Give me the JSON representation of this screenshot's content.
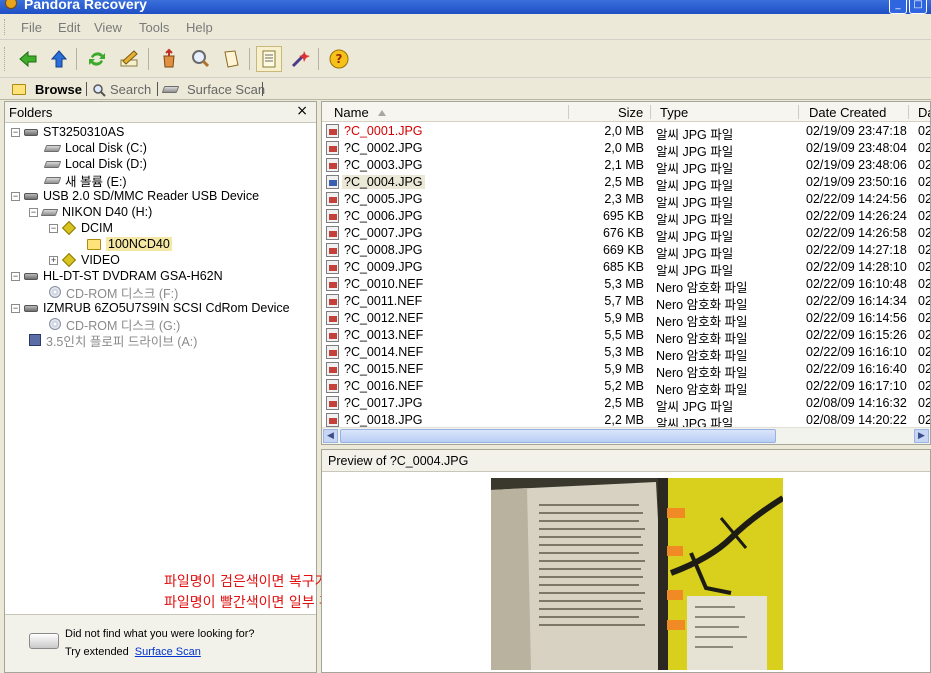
{
  "window": {
    "title": "Pandora Recovery"
  },
  "menu": [
    "File",
    "Edit",
    "View",
    "Tools",
    "Help"
  ],
  "tabs": [
    {
      "label": "Browse",
      "active": true
    },
    {
      "label": "Search",
      "active": false
    },
    {
      "label": "Surface Scan",
      "active": false
    }
  ],
  "folders": {
    "header": "Folders",
    "close": "×",
    "tree": [
      {
        "label": "ST3250310AS"
      },
      {
        "label": "Local Disk (C:)"
      },
      {
        "label": "Local Disk (D:)"
      },
      {
        "label": "새 볼륨 (E:)"
      },
      {
        "label": "USB 2.0 SD/MMC Reader USB Device"
      },
      {
        "label": "NIKON D40 (H:)"
      },
      {
        "label": "DCIM"
      },
      {
        "label": "100NCD40"
      },
      {
        "label": "VIDEO"
      },
      {
        "label": "HL-DT-ST DVDRAM GSA-H62N"
      },
      {
        "label": "CD-ROM 디스크 (F:)"
      },
      {
        "label": "IZMRUB 6ZO5U7S9IN SCSI CdRom Device"
      },
      {
        "label": "CD-ROM 디스크 (G:)"
      },
      {
        "label": "3.5인치 플로피 드라이브 (A:)"
      }
    ],
    "hint_line1": "Did not find what you were looking for?",
    "hint_line2": "Try extended",
    "hint_link": "Surface Scan"
  },
  "file_list": {
    "columns": {
      "name": "Name",
      "size": "Size",
      "type": "Type",
      "date": "Date Created",
      "extra": "Da"
    },
    "rows": [
      {
        "name": "?C_0001.JPG",
        "size": "2,0 MB",
        "type": "알씨 JPG 파일",
        "date": "02/19/09 23:47:18",
        "extra": "02/",
        "status": "red"
      },
      {
        "name": "?C_0002.JPG",
        "size": "2,0 MB",
        "type": "알씨 JPG 파일",
        "date": "02/19/09 23:48:04",
        "extra": "02/",
        "status": "black"
      },
      {
        "name": "?C_0003.JPG",
        "size": "2,1 MB",
        "type": "알씨 JPG 파일",
        "date": "02/19/09 23:48:06",
        "extra": "02/",
        "status": "black"
      },
      {
        "name": "?C_0004.JPG",
        "size": "2,5 MB",
        "type": "알씨 JPG 파일",
        "date": "02/19/09 23:50:16",
        "extra": "02/",
        "status": "black"
      },
      {
        "name": "?C_0005.JPG",
        "size": "2,3 MB",
        "type": "알씨 JPG 파일",
        "date": "02/22/09 14:24:56",
        "extra": "02/",
        "status": "black"
      },
      {
        "name": "?C_0006.JPG",
        "size": "695 KB",
        "type": "알씨 JPG 파일",
        "date": "02/22/09 14:26:24",
        "extra": "02/",
        "status": "black"
      },
      {
        "name": "?C_0007.JPG",
        "size": "676 KB",
        "type": "알씨 JPG 파일",
        "date": "02/22/09 14:26:58",
        "extra": "02/",
        "status": "black"
      },
      {
        "name": "?C_0008.JPG",
        "size": "669 KB",
        "type": "알씨 JPG 파일",
        "date": "02/22/09 14:27:18",
        "extra": "02/",
        "status": "black"
      },
      {
        "name": "?C_0009.JPG",
        "size": "685 KB",
        "type": "알씨 JPG 파일",
        "date": "02/22/09 14:28:10",
        "extra": "02/",
        "status": "black"
      },
      {
        "name": "?C_0010.NEF",
        "size": "5,3 MB",
        "type": "Nero 암호화 파일",
        "date": "02/22/09 16:10:48",
        "extra": "02/",
        "status": "black"
      },
      {
        "name": "?C_0011.NEF",
        "size": "5,7 MB",
        "type": "Nero 암호화 파일",
        "date": "02/22/09 16:14:34",
        "extra": "02/",
        "status": "black"
      },
      {
        "name": "?C_0012.NEF",
        "size": "5,9 MB",
        "type": "Nero 암호화 파일",
        "date": "02/22/09 16:14:56",
        "extra": "02/",
        "status": "black"
      },
      {
        "name": "?C_0013.NEF",
        "size": "5,5 MB",
        "type": "Nero 암호화 파일",
        "date": "02/22/09 16:15:26",
        "extra": "02/",
        "status": "black"
      },
      {
        "name": "?C_0014.NEF",
        "size": "5,3 MB",
        "type": "Nero 암호화 파일",
        "date": "02/22/09 16:16:10",
        "extra": "02/",
        "status": "black"
      },
      {
        "name": "?C_0015.NEF",
        "size": "5,9 MB",
        "type": "Nero 암호화 파일",
        "date": "02/22/09 16:16:40",
        "extra": "02/",
        "status": "black"
      },
      {
        "name": "?C_0016.NEF",
        "size": "5,2 MB",
        "type": "Nero 암호화 파일",
        "date": "02/22/09 16:17:10",
        "extra": "02/",
        "status": "black"
      },
      {
        "name": "?C_0017.JPG",
        "size": "2,5 MB",
        "type": "알씨 JPG 파일",
        "date": "02/08/09 14:16:32",
        "extra": "02/",
        "status": "black"
      },
      {
        "name": "?C_0018.JPG",
        "size": "2,2 MB",
        "type": "알씨 JPG 파일",
        "date": "02/08/09 14:20:22",
        "extra": "02/",
        "status": "black"
      }
    ]
  },
  "preview": {
    "title": "Preview of ?C_0004.JPG"
  },
  "annotations": {
    "line1": "파일명이 검은색이면 복구가능",
    "line2": "파일명이 빨간색이면 일부 혹은 전부 복구불가가"
  },
  "colors": {
    "accent": "#1e4fc4",
    "deleted_red": "#d60000",
    "annotation_red": "#e01010"
  },
  "icons": [
    "back-icon",
    "up-icon",
    "refresh-icon",
    "edit-icon",
    "recover-icon",
    "search-icon",
    "page-icon",
    "properties-icon",
    "wand-icon",
    "help-icon"
  ]
}
